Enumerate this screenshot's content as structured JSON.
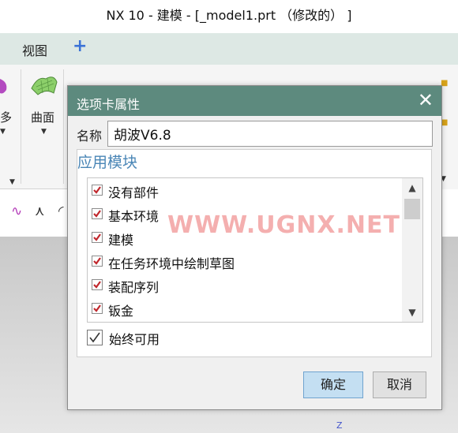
{
  "window": {
    "title": "NX 10 - 建模 - [_model1.prt （修改的） ]"
  },
  "menubar": {
    "view_label": "视图",
    "add_label": "+"
  },
  "ribbon": {
    "more_label": "多",
    "surface_label": "曲面"
  },
  "viewport": {
    "z_axis_label": "Z"
  },
  "dialog": {
    "title": "选项卡属性",
    "close_symbol": "✕",
    "name_label": "名称",
    "name_value": "胡波V6.8",
    "section_title": "应用模块",
    "modules": [
      {
        "label": "没有部件",
        "checked": true
      },
      {
        "label": "基本环境",
        "checked": true
      },
      {
        "label": "建模",
        "checked": true
      },
      {
        "label": "在任务环境中绘制草图",
        "checked": true
      },
      {
        "label": "装配序列",
        "checked": true
      },
      {
        "label": "钣金",
        "checked": true
      }
    ],
    "always_available_label": "始终可用",
    "always_available_checked": true,
    "ok_label": "确定",
    "cancel_label": "取消"
  },
  "watermark": "WWW.UGNX.NET",
  "colors": {
    "dialog_header": "#5d8a7e",
    "section_title": "#4a86b6",
    "checkbox_mark": "#c0282d",
    "ok_button": "#c4dff2"
  }
}
